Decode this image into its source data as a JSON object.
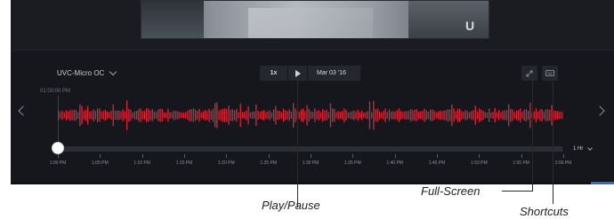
{
  "player": {
    "camera_name": "UVC-Micro OC",
    "speed": "1x",
    "date": "Mar 03 '16",
    "start_time_label": "01:00:00 PM",
    "zoom_label": "1 Hr",
    "time_ticks": [
      "1:00 PM",
      "1:05 PM",
      "1:10 PM",
      "1:15 PM",
      "1:20 PM",
      "1:25 PM",
      "1:30 PM",
      "1:35 PM",
      "1:40 PM",
      "1:45 PM",
      "1:50 PM",
      "1:55 PM",
      "2:00 PM"
    ],
    "playhead_position": 0
  },
  "callouts": {
    "play_pause": "Play/Pause",
    "full_screen": "Full-Screen",
    "shortcuts": "Shortcuts"
  },
  "colors": {
    "accent_wave": "#d8263a",
    "player_bg": "#15171c",
    "control_bg": "#24272e",
    "callout_line": "#4a90d9"
  },
  "icons": {
    "play": "play-icon",
    "fullscreen": "fullscreen-icon",
    "keyboard": "keyboard-icon",
    "nav_left": "chevron-left-icon",
    "nav_right": "chevron-right-icon"
  }
}
